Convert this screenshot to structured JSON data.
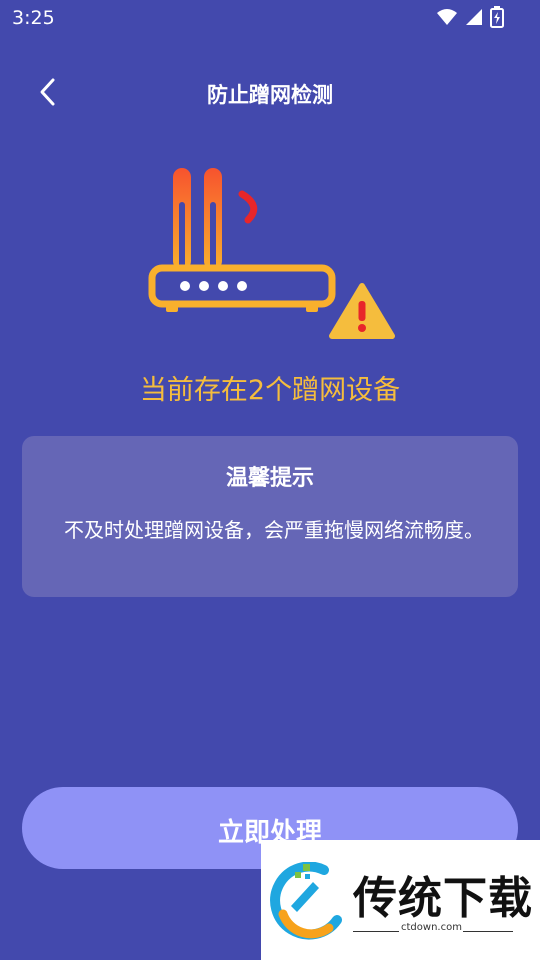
{
  "status_bar": {
    "time": "3:25",
    "icons": [
      "wifi-icon",
      "signal-icon",
      "battery-charging-icon"
    ]
  },
  "nav": {
    "back_icon": "chevron-left-icon",
    "title": "防止蹭网检测"
  },
  "illustration": {
    "icon": "router-warning-icon",
    "colors": {
      "router": "#f9b02d",
      "antenna_top": "#f7532e",
      "signal": "#e8262a",
      "warning": "#f5bd3d"
    }
  },
  "headline": "当前存在2个蹭网设备",
  "tip": {
    "title": "温馨提示",
    "body": "不及时处理蹭网设备，会严重拖慢网络流畅度。"
  },
  "action": {
    "label": "立即处理"
  },
  "watermark": {
    "title": "传统下载",
    "subtitle": "ctdown.com"
  },
  "colors": {
    "background": "#4349ad",
    "card": "#6566b6",
    "button": "#8f92f6",
    "accent_text": "#f5bd3d"
  }
}
